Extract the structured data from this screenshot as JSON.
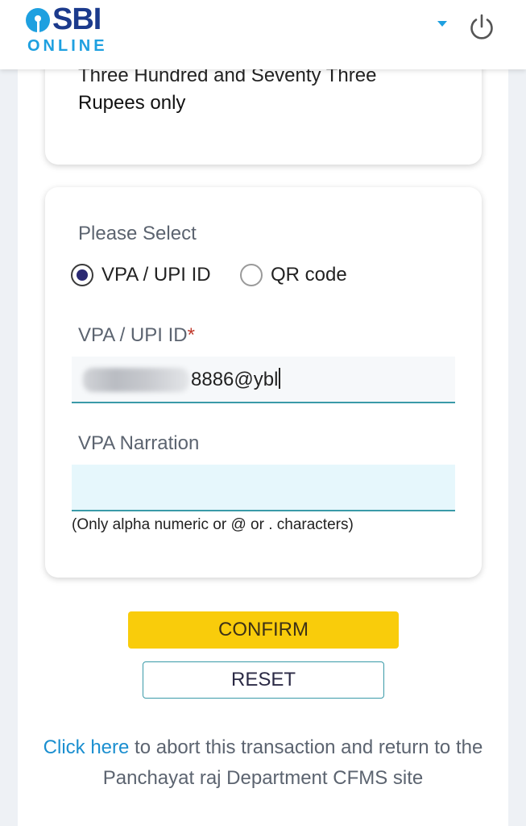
{
  "header": {
    "logo_sbi": "SBI",
    "logo_online": "ONLINE",
    "brand_color": "#1b3a8c",
    "accent_color": "#1ea0e0",
    "icons": [
      "sbi-logo-icon",
      "dropdown-caret-icon",
      "power-icon"
    ]
  },
  "amount_card": {
    "amount_words_partial": "Three Hundred and Seventy Three",
    "amount_words_suffix": "Rupees only"
  },
  "form": {
    "please_select_label": "Please Select",
    "options": [
      {
        "label": "VPA / UPI ID",
        "selected": true
      },
      {
        "label": "QR code",
        "selected": false
      }
    ],
    "vpa_label": "VPA / UPI ID",
    "required_marker": "*",
    "vpa_value_visible": "8886@ybl",
    "narration_label": "VPA Narration",
    "narration_value": "",
    "narration_hint": "(Only alpha numeric or @ or . characters)"
  },
  "buttons": {
    "confirm_label": "CONFIRM",
    "reset_label": "RESET",
    "confirm_color": "#f9cc0b"
  },
  "footer": {
    "abort_link_text": "Click here",
    "abort_text_rest": " to abort this transaction and return to the Panchayat raj Department CFMS site"
  }
}
